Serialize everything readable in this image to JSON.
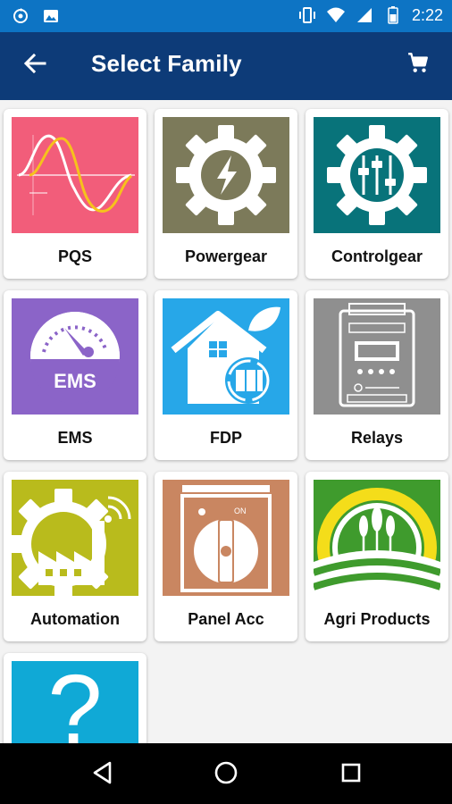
{
  "status_bar": {
    "time": "2:22",
    "icons": [
      "sync-icon",
      "image-icon",
      "vibrate-icon",
      "wifi-icon",
      "signal-icon",
      "battery-icon"
    ]
  },
  "app_bar": {
    "title": "Select Family",
    "back_icon": "arrow-left-icon",
    "cart_icon": "cart-icon"
  },
  "families": [
    {
      "label": "PQS",
      "icon": "waveform-icon",
      "color": "#f25d7a"
    },
    {
      "label": "Powergear",
      "icon": "gear-bolt-icon",
      "color": "#7c7a5a"
    },
    {
      "label": "Controlgear",
      "icon": "gear-sliders-icon",
      "color": "#08737a"
    },
    {
      "label": "EMS",
      "icon": "ems-gauge-icon",
      "color": "#8b64c8"
    },
    {
      "label": "FDP",
      "icon": "house-leaf-icon",
      "color": "#27a7e8"
    },
    {
      "label": "Relays",
      "icon": "relay-device-icon",
      "color": "#8f8f8f"
    },
    {
      "label": "Automation",
      "icon": "factory-gear-icon",
      "color": "#b9bb1c"
    },
    {
      "label": "Panel Acc",
      "icon": "rotary-switch-icon",
      "color": "#c98661"
    },
    {
      "label": "Agri Products",
      "icon": "crops-field-icon",
      "color": "#3f9b2d"
    },
    {
      "label": "",
      "icon": "question-mark-icon",
      "color": "#10a9d6"
    }
  ],
  "nav_bar": {
    "icons": [
      "back-triangle-icon",
      "home-circle-icon",
      "recents-square-icon"
    ]
  }
}
